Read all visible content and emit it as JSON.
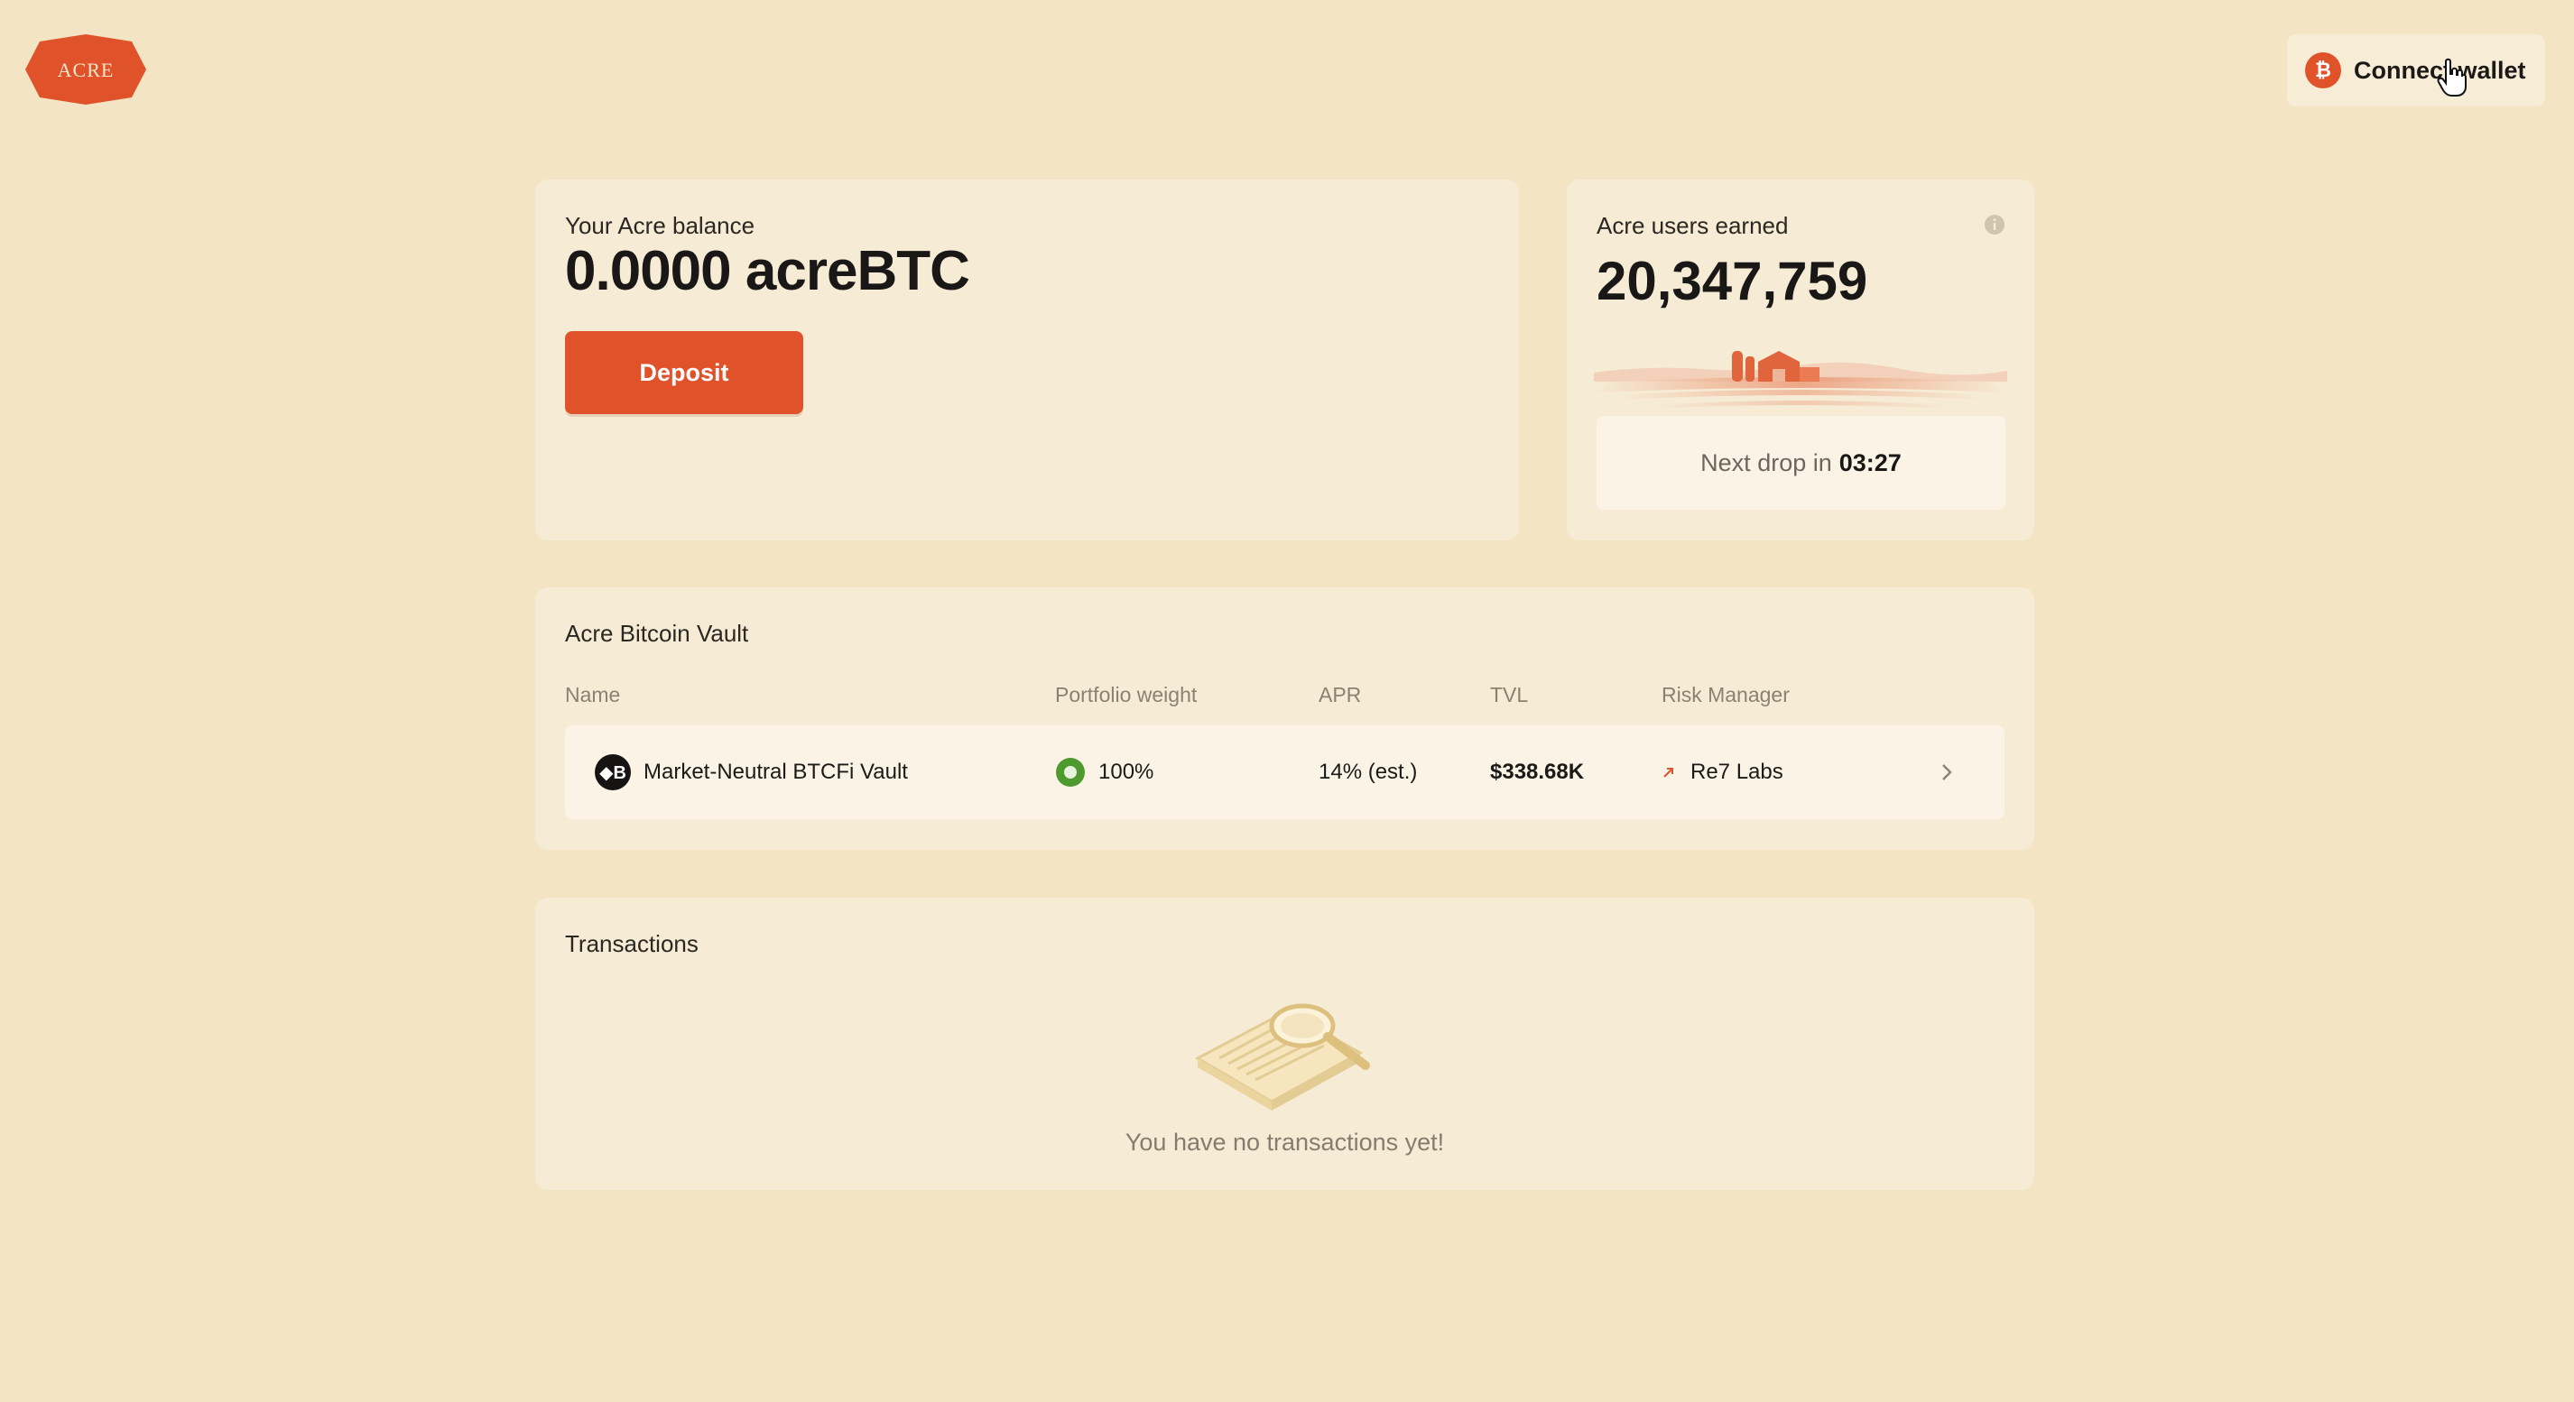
{
  "header": {
    "logo_text": "ACRE",
    "connect_wallet_label": "Connect wallet",
    "connect_icon": "bitcoin-icon",
    "connect_icon_glyph": "₿"
  },
  "balance": {
    "label": "Your Acre balance",
    "amount": "0.0000",
    "unit": "acreBTC",
    "deposit_label": "Deposit"
  },
  "earned": {
    "label": "Acre users earned",
    "value": "20,347,759",
    "next_drop_label": "Next drop in",
    "next_drop_time": "03:27",
    "info_icon": "info-icon"
  },
  "vault": {
    "title": "Acre Bitcoin Vault",
    "columns": {
      "name": "Name",
      "weight": "Portfolio weight",
      "apr": "APR",
      "tvl": "TVL",
      "risk_manager": "Risk Manager"
    },
    "rows": [
      {
        "icon_glyph": "◆B",
        "name": "Market-Neutral BTCFi Vault",
        "weight": "100%",
        "apr": "14% (est.)",
        "tvl": "$338.68K",
        "risk_manager": "Re7 Labs"
      }
    ]
  },
  "transactions": {
    "title": "Transactions",
    "empty_text": "You have no transactions yet!"
  },
  "colors": {
    "background": "#f3e4c3",
    "card": "#f6ebd5",
    "accent": "#e0532a",
    "success": "#4e9a2f"
  }
}
